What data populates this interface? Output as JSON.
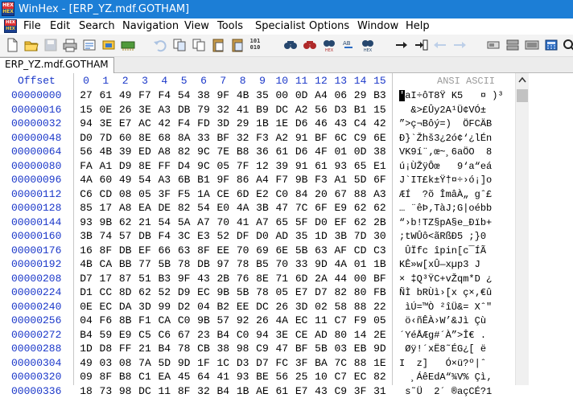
{
  "window": {
    "title": "WinHex - [ERP_YZ.mdf.GOTHAM]",
    "icon_text_top": "HEX",
    "icon_text_bottom": "HEX"
  },
  "menu": {
    "icon_text_top": "HEX",
    "icon_text_bottom": "HEX",
    "items": [
      "File",
      "Edit",
      "Search",
      "Navigation",
      "View",
      "Tools",
      "Specialist",
      "Options",
      "Window",
      "Help"
    ]
  },
  "toolbar": {
    "buttons": [
      "new-file",
      "open-file",
      "save",
      "print",
      "properties",
      "open-disk",
      "undo",
      "copy",
      "copy-block",
      "paste",
      "paste-special",
      "binary-convert",
      "find-text",
      "find-hex",
      "replace-text",
      "replace-hex",
      "find-hex-alt",
      "goto-offset",
      "goto-page",
      "back",
      "forward",
      "disk-tools",
      "ram-editor",
      "disk-editor",
      "calculator",
      "more"
    ],
    "binary_label": "101 010",
    "hex_label": "HEX",
    "ab_label": "AB"
  },
  "tab": {
    "label": "ERP_YZ.mdf.GOTHAM"
  },
  "hex_view": {
    "offset_header": "Offset",
    "column_headers": [
      "0",
      "1",
      "2",
      "3",
      "4",
      "5",
      "6",
      "7",
      "8",
      "9",
      "10",
      "11",
      "12",
      "13",
      "14",
      "15"
    ],
    "ansi_header": "ANSI ASCII",
    "rows": [
      {
        "offset": "00000000",
        "bytes": [
          "27",
          "61",
          "49",
          "F7",
          "F4",
          "54",
          "38",
          "9F",
          "4B",
          "35",
          "00",
          "0D",
          "A4",
          "06",
          "29",
          "B3"
        ],
        "ansi": "'aI÷ôT8Ÿ K5   ¤ )³"
      },
      {
        "offset": "00000016",
        "bytes": [
          "15",
          "0E",
          "26",
          "3E",
          "A3",
          "DB",
          "79",
          "32",
          "41",
          "B9",
          "DC",
          "A2",
          "56",
          "D3",
          "B1",
          "15"
        ],
        "ansi": "  &>£Ûy2A¹Ü¢VÓ±"
      },
      {
        "offset": "00000032",
        "bytes": [
          "94",
          "3E",
          "E7",
          "AC",
          "42",
          "F4",
          "FD",
          "3D",
          "29",
          "1B",
          "1E",
          "D6",
          "46",
          "43",
          "C4",
          "42"
        ],
        "ansi": "”>ç¬Bôý=)  ÖFCÄB"
      },
      {
        "offset": "00000048",
        "bytes": [
          "D0",
          "7D",
          "60",
          "8E",
          "68",
          "8A",
          "33",
          "BF",
          "32",
          "F3",
          "A2",
          "91",
          "BF",
          "6C",
          "C9",
          "6E"
        ],
        "ansi": "Ð}`Žhš3¿2ó¢‘¿lÉn"
      },
      {
        "offset": "00000064",
        "bytes": [
          "56",
          "4B",
          "39",
          "ED",
          "A8",
          "82",
          "9C",
          "7E",
          "B8",
          "36",
          "61",
          "D6",
          "4F",
          "01",
          "0D",
          "38"
        ],
        "ansi": "VK9í¨‚œ~¸6aÖO  8"
      },
      {
        "offset": "00000080",
        "bytes": [
          "FA",
          "A1",
          "D9",
          "8E",
          "FF",
          "D4",
          "9C",
          "05",
          "7F",
          "12",
          "39",
          "91",
          "61",
          "93",
          "65",
          "E1"
        ],
        "ansi": "ú¡ÙŽÿÔœ   9‘a“eá"
      },
      {
        "offset": "00000096",
        "bytes": [
          "4A",
          "60",
          "49",
          "54",
          "A3",
          "6B",
          "B1",
          "9F",
          "86",
          "A4",
          "F7",
          "9B",
          "F3",
          "A1",
          "5D",
          "6F"
        ],
        "ansi": "J`IT£k±Ÿ†¤÷›ó¡]o"
      },
      {
        "offset": "00000112",
        "bytes": [
          "C6",
          "CD",
          "08",
          "05",
          "3F",
          "F5",
          "1A",
          "CE",
          "6D",
          "E2",
          "C0",
          "84",
          "20",
          "67",
          "88",
          "A3"
        ],
        "ansi": "ÆÍ  ?õ ÎmâÀ„ gˆ£"
      },
      {
        "offset": "00000128",
        "bytes": [
          "85",
          "17",
          "A8",
          "EA",
          "DE",
          "82",
          "54",
          "E0",
          "4A",
          "3B",
          "47",
          "7C",
          "6F",
          "E9",
          "62",
          "62"
        ],
        "ansi": "… ¨êÞ‚TàJ;G|oébb"
      },
      {
        "offset": "00000144",
        "bytes": [
          "93",
          "9B",
          "62",
          "21",
          "54",
          "5A",
          "A7",
          "70",
          "41",
          "A7",
          "65",
          "5F",
          "D0",
          "EF",
          "62",
          "2B"
        ],
        "ansi": "“›b!TZ§pA§e_Ðïb+"
      },
      {
        "offset": "00000160",
        "bytes": [
          "3B",
          "74",
          "57",
          "DB",
          "F4",
          "3C",
          "E3",
          "52",
          "DF",
          "D0",
          "AD",
          "35",
          "1D",
          "3B",
          "7D",
          "30"
        ],
        "ansi": ";tWÛô<ãRßÐ­5 ;}0"
      },
      {
        "offset": "00000176",
        "bytes": [
          "16",
          "8F",
          "DB",
          "EF",
          "66",
          "63",
          "8F",
          "EE",
          "70",
          "69",
          "6E",
          "5B",
          "63",
          "AF",
          "CD",
          "C3"
        ],
        "ansi": " ÛÏfc îpin[c¯ÍÃ"
      },
      {
        "offset": "00000192",
        "bytes": [
          "4B",
          "CA",
          "BB",
          "77",
          "5B",
          "78",
          "DB",
          "97",
          "78",
          "B5",
          "70",
          "33",
          "9D",
          "4A",
          "01",
          "1B"
        ],
        "ansi": "KÊ»w[xÛ—xµp3 J  "
      },
      {
        "offset": "00000208",
        "bytes": [
          "D7",
          "17",
          "87",
          "51",
          "B3",
          "9F",
          "43",
          "2B",
          "76",
          "8E",
          "71",
          "6D",
          "2A",
          "44",
          "00",
          "BF"
        ],
        "ansi": "× ‡Q³ŸC+vŽqm*D ¿"
      },
      {
        "offset": "00000224",
        "bytes": [
          "D1",
          "CC",
          "8D",
          "62",
          "52",
          "D9",
          "EC",
          "9B",
          "5B",
          "78",
          "05",
          "E7",
          "D7",
          "82",
          "80",
          "FB"
        ],
        "ansi": "ÑÌ bRÙì›[x ç×‚€û"
      },
      {
        "offset": "00000240",
        "bytes": [
          "0E",
          "EC",
          "DA",
          "3D",
          "99",
          "D2",
          "04",
          "B2",
          "EE",
          "DC",
          "26",
          "3D",
          "02",
          "58",
          "88",
          "22"
        ],
        "ansi": " ìÚ=™Ò ²îÜ&= Xˆ\""
      },
      {
        "offset": "00000256",
        "bytes": [
          "04",
          "F6",
          "8B",
          "F1",
          "CA",
          "C0",
          "9B",
          "57",
          "92",
          "26",
          "4A",
          "EC",
          "11",
          "C7",
          "F9",
          "05"
        ],
        "ansi": " ö‹ñÊÀ›W’&Jì Çù "
      },
      {
        "offset": "00000272",
        "bytes": [
          "B4",
          "59",
          "E9",
          "C5",
          "C6",
          "67",
          "23",
          "B4",
          "C0",
          "94",
          "3E",
          "CE",
          "AD",
          "80",
          "14",
          "2E"
        ],
        "ansi": "´YéÅÆg#´À”>Î­€ ."
      },
      {
        "offset": "00000288",
        "bytes": [
          "1D",
          "D8",
          "FF",
          "21",
          "B4",
          "78",
          "CB",
          "38",
          "98",
          "C9",
          "47",
          "BF",
          "5B",
          "03",
          "EB",
          "9D"
        ],
        "ansi": " Øÿ!´xË8˜ÉG¿[ ë "
      },
      {
        "offset": "00000304",
        "bytes": [
          "49",
          "03",
          "08",
          "7A",
          "5D",
          "9D",
          "1F",
          "1C",
          "D3",
          "D7",
          "FC",
          "3F",
          "BA",
          "7C",
          "88",
          "1E"
        ],
        "ansi": "I  z]   Ó×ü?º|ˆ "
      },
      {
        "offset": "00000320",
        "bytes": [
          "09",
          "8F",
          "B8",
          "C1",
          "EA",
          "45",
          "64",
          "41",
          "93",
          "BE",
          "56",
          "25",
          "10",
          "C7",
          "EC",
          "82"
        ],
        "ansi": "  ¸ÁêEdA“¾V% Çì‚"
      },
      {
        "offset": "00000336",
        "bytes": [
          "18",
          "73",
          "98",
          "DC",
          "11",
          "8F",
          "32",
          "B4",
          "1B",
          "AE",
          "61",
          "E7",
          "43",
          "C9",
          "3F",
          "31"
        ],
        "ansi": " s˜Ü  2´ ®açCÉ?1"
      }
    ]
  }
}
